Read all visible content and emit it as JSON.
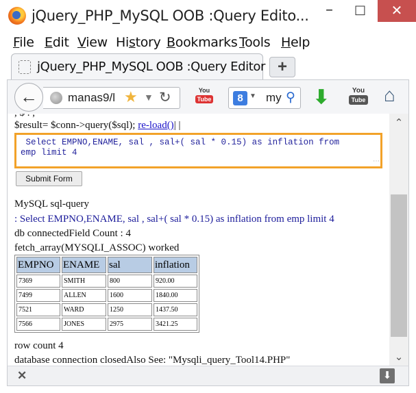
{
  "window": {
    "title": "jQuery_PHP_MySQL OOB :Query Edito...",
    "minimize": "–",
    "maximize": "□",
    "close": "✕"
  },
  "menu": [
    {
      "label": "File",
      "key": "F",
      "rest": "ile"
    },
    {
      "label": "Edit",
      "key": "E",
      "rest": "dit"
    },
    {
      "label": "View",
      "key": "V",
      "rest": "iew"
    },
    {
      "label": "History",
      "key": "s",
      "pre": "Hi",
      "rest": "tory"
    },
    {
      "label": "Bookmarks",
      "key": "B",
      "rest": "ookmarks"
    },
    {
      "label": "Tools",
      "key": "T",
      "rest": "ools"
    },
    {
      "label": "Help",
      "key": "H",
      "rest": "elp"
    }
  ],
  "tab": {
    "label": "jQuery_PHP_MySQL OOB :Query Editor",
    "new_tab": "+"
  },
  "navbar": {
    "url": "manas9/l",
    "search_text": "my",
    "icons": [
      "back-icon",
      "globe-icon",
      "star-icon",
      "reload-icon",
      "youtube-addon-icon",
      "google-icon",
      "search-icon",
      "download-icon",
      "youtube-icon",
      "home-icon"
    ]
  },
  "page": {
    "cut_line": "        , $ . ,",
    "result_line_prefix": "$result= $conn->query($sql); ",
    "reload_link": "re-load()",
    "result_line_suffix": "| |",
    "sql_text": " Select EMPNO,ENAME, sal , sal+( sal * 0.15) as inflation from\nemp limit 4",
    "submit_label": "Submit Form",
    "line1": "MySQL sql-query",
    "line2": ": Select EMPNO,ENAME, sal , sal+( sal * 0.15) as inflation from emp limit 4",
    "line3": "db connectedField Count : 4",
    "line4": "fetch_array(MYSQLI_ASSOC) worked",
    "table": {
      "headers": [
        "EMPNO",
        "ENAME",
        "sal",
        "inflation"
      ],
      "rows": [
        [
          "7369",
          "SMITH",
          "800",
          "920.00"
        ],
        [
          "7499",
          "ALLEN",
          "1600",
          "1840.00"
        ],
        [
          "7521",
          "WARD",
          "1250",
          "1437.50"
        ],
        [
          "7566",
          "JONES",
          "2975",
          "3421.25"
        ]
      ]
    },
    "line5": "row count 4",
    "line6": "database connection closedAlso See: \"Mysqli_query_Tool14.PHP\""
  },
  "findbar": {
    "close": "✕",
    "download": "⬇"
  },
  "colors": {
    "sql_border": "#f2a229",
    "table_header": "#b8cce4",
    "link": "#1a12c9",
    "close_button": "#c7504f"
  }
}
